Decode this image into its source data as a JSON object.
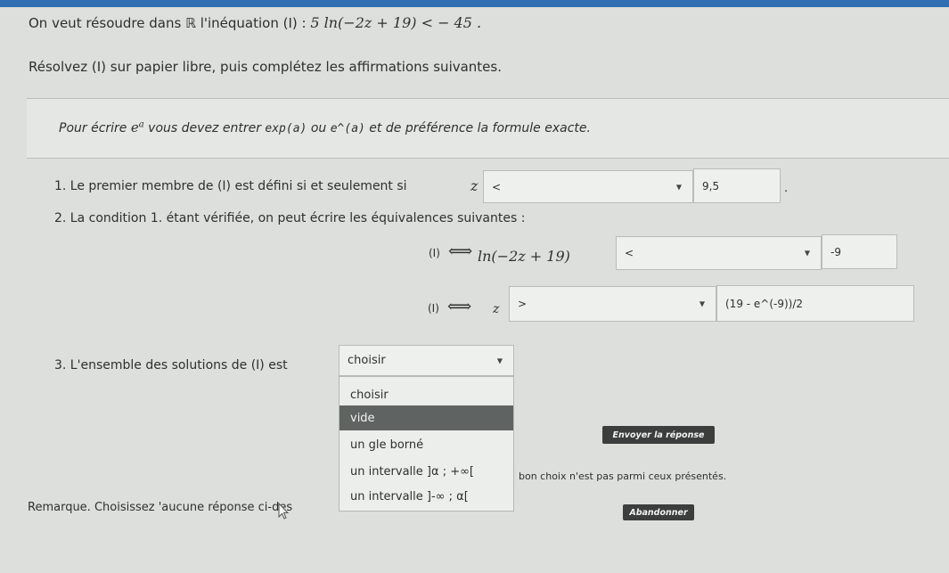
{
  "header": {
    "intro_text": "On veut résoudre dans ℝ l'inéquation (I) : ",
    "inequation": "5 ln(−2z + 19) < − 45 .",
    "instruction": "Résolvez (I) sur papier libre, puis complétez les affirmations suivantes."
  },
  "info": {
    "text_before": "Pour écrire ",
    "exp_base": "e",
    "exp_power": "a",
    "text_middle": " vous devez entrer ",
    "code_exp": "exp(a)",
    "text_or": " ou ",
    "code_caret": "e^(a)",
    "text_after": " et de préférence la formule exacte."
  },
  "q1": {
    "label": "1. Le premier membre de (I) est défini si et seulement si",
    "variable": "z",
    "operator_selected": "<",
    "answer_value": "9,5",
    "trailing": "."
  },
  "q2": {
    "label": "2. La condition 1. étant vérifiée, on peut écrire les équivalences suivantes :",
    "line1": {
      "prefix": "(I)",
      "arrow": "⟺",
      "expression": "ln(−2z + 19)",
      "operator_selected": "<",
      "answer_value": "-9"
    },
    "line2": {
      "prefix": "(I)",
      "arrow": "⟺",
      "variable": "z",
      "operator_selected": ">",
      "answer_value": "(19 - e^(-9))/2"
    }
  },
  "q3": {
    "label": "3. L'ensemble des solutions de (I) est",
    "selected": "choisir",
    "options": [
      "choisir",
      "vide",
      "un gle borné",
      "un intervalle ]α ; +∞[",
      "un intervalle ]-∞ ; α["
    ],
    "highlighted_index": 1
  },
  "remark": {
    "text_start": "Remarque. Choisissez 'aucune réponse ci-des",
    "text_end": "bon choix n'est pas parmi ceux présentés."
  },
  "buttons": {
    "submit": "Envoyer la réponse",
    "abandon": "Abandonner"
  },
  "colors": {
    "background": "#dcdfdc",
    "top_accent": "#2f6fb3",
    "button_dark": "#3b3e3c",
    "highlight_option": "#5f6361"
  }
}
